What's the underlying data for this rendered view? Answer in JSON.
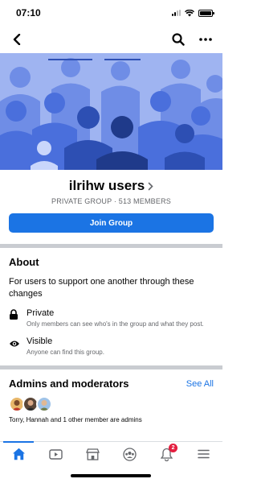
{
  "status_bar": {
    "time": "07:10",
    "battery_level": 1.0
  },
  "nav": {
    "back_icon": "back-arrow-icon",
    "search_icon": "search-icon",
    "more_icon": "more-dots-icon"
  },
  "cover": {
    "illustration": "people-crowd-illustration",
    "palette": [
      "#9fb4f1",
      "#4a6fdc",
      "#2d4fb3",
      "#1f3a8a"
    ]
  },
  "group": {
    "name": "ilrihw users",
    "meta": "PRIVATE GROUP · 513 MEMBERS",
    "join_label": "Join Group"
  },
  "about": {
    "title": "About",
    "description": "For users to support one another through these changes",
    "items": [
      {
        "icon": "lock-icon",
        "title": "Private",
        "subtitle": "Only members can see who's in the group and what they post."
      },
      {
        "icon": "eye-icon",
        "title": "Visible",
        "subtitle": "Anyone can find this group."
      }
    ]
  },
  "admins": {
    "title": "Admins and moderators",
    "see_all": "See All",
    "summary": "Torry, Hannah and 1 other member are admins",
    "avatar_count": 3
  },
  "bottom_nav": {
    "tabs": [
      {
        "name": "tab-home",
        "icon": "home-icon",
        "active": true
      },
      {
        "name": "tab-watch",
        "icon": "video-icon",
        "active": false
      },
      {
        "name": "tab-marketplace",
        "icon": "marketplace-icon",
        "active": false
      },
      {
        "name": "tab-groups",
        "icon": "groups-icon",
        "active": false
      },
      {
        "name": "tab-notifications",
        "icon": "bell-icon",
        "active": false,
        "badge": "2"
      },
      {
        "name": "tab-menu",
        "icon": "menu-icon",
        "active": false
      }
    ]
  },
  "colors": {
    "accent": "#1b74e4",
    "badge": "#e41e3f",
    "secondary_text": "#65676b"
  }
}
